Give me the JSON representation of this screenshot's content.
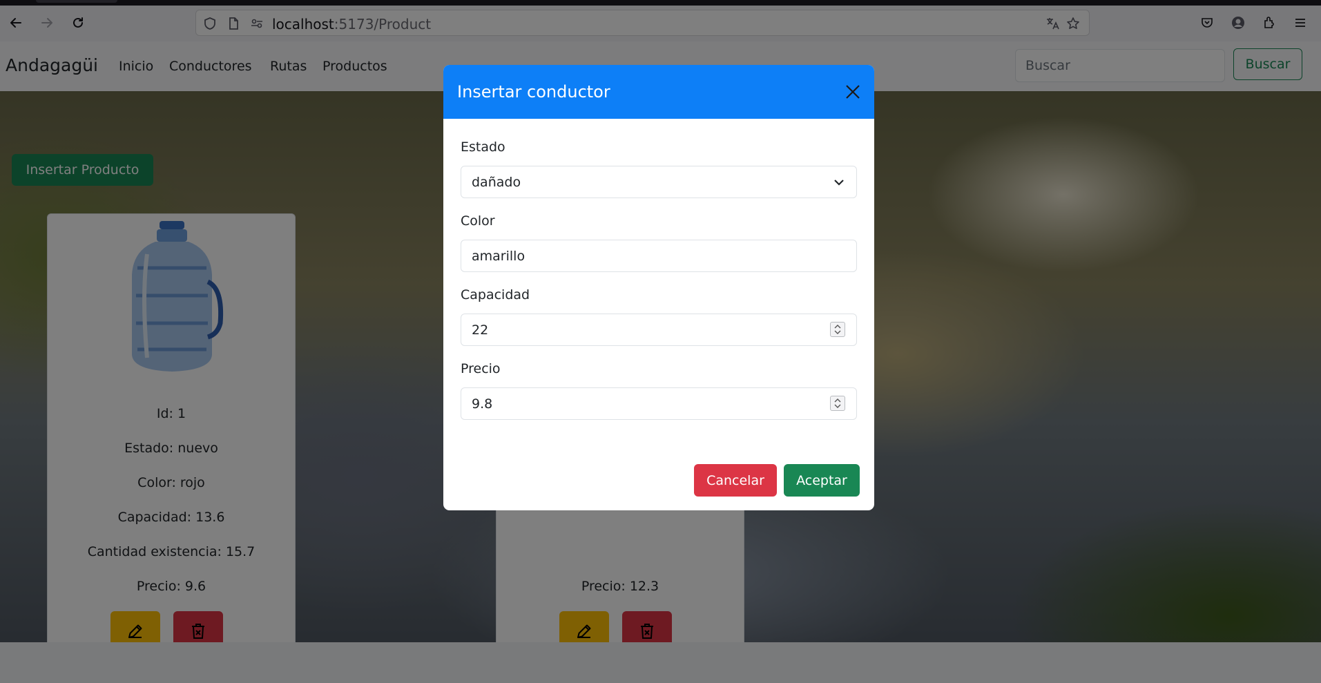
{
  "browser": {
    "url_host": "localhost",
    "url_path": ":5173/Product"
  },
  "navbar": {
    "brand": "Andagagüi",
    "links": [
      "Inicio",
      "Conductores",
      "Rutas",
      "Productos"
    ],
    "search_placeholder": "Buscar",
    "search_button": "Buscar"
  },
  "page": {
    "insert_button": "Insertar Producto"
  },
  "cards": [
    {
      "id": "Id: 1",
      "estado": "Estado: nuevo",
      "color": "Color: rojo",
      "capacidad": "Capacidad: 13.6",
      "cantidad": "Cantidad existencia: 15.7",
      "precio": "Precio: 9.6"
    },
    {
      "precio": "Precio: 12.3"
    }
  ],
  "modal": {
    "title": "Insertar conductor",
    "fields": {
      "estado_label": "Estado",
      "estado_value": "dañado",
      "color_label": "Color",
      "color_value": "amarillo",
      "capacidad_label": "Capacidad",
      "capacidad_value": "22",
      "precio_label": "Precio",
      "precio_value": "9.8"
    },
    "cancel_label": "Cancelar",
    "accept_label": "Aceptar"
  },
  "colors": {
    "primary": "#0d7ff7",
    "success": "#198754",
    "danger": "#dc3545",
    "warning": "#ffc107"
  }
}
